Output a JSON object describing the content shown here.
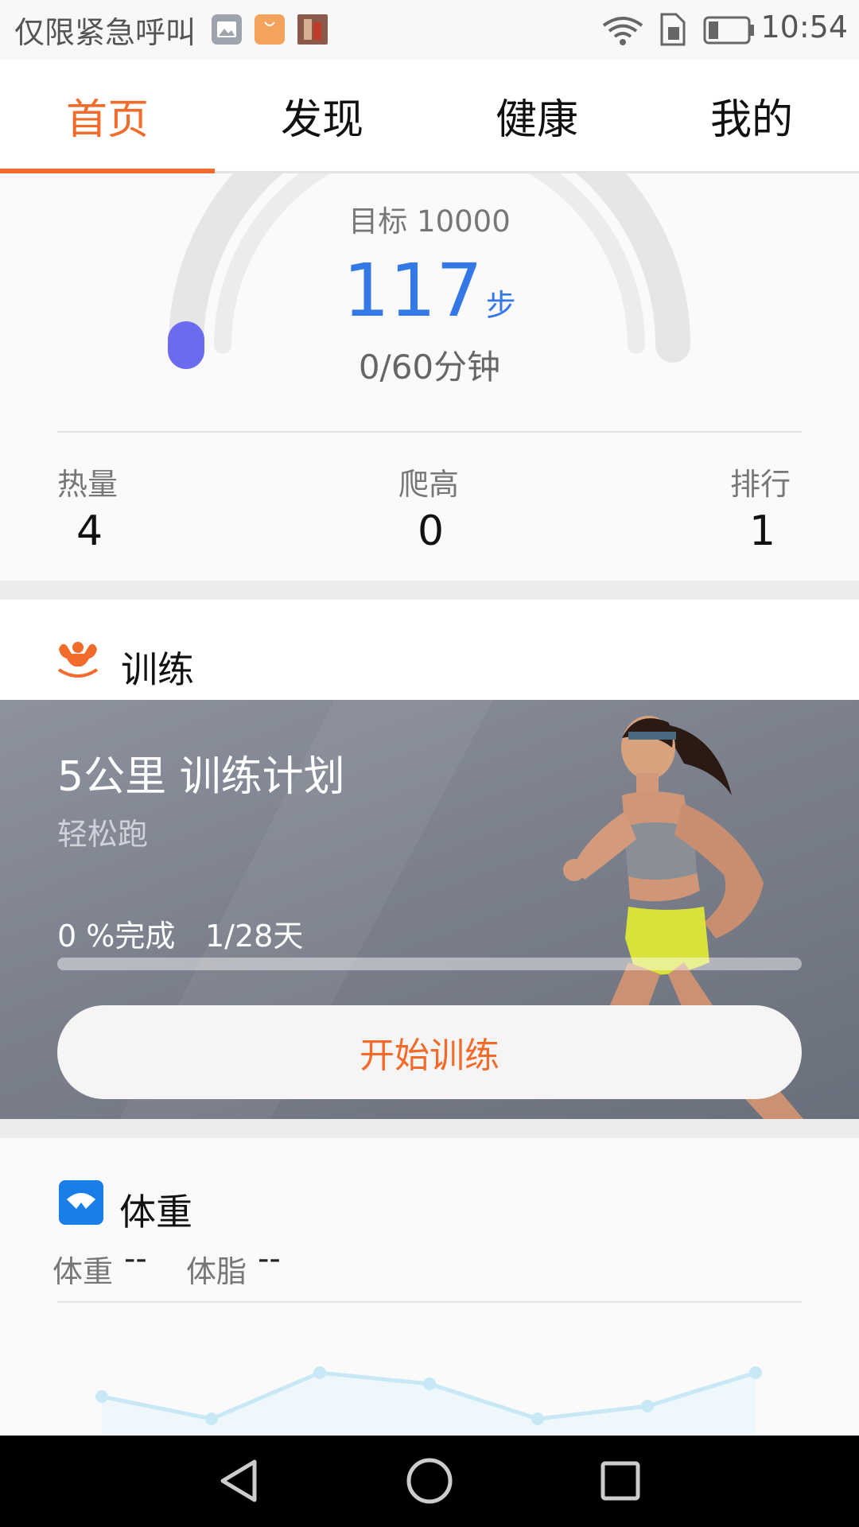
{
  "status_bar": {
    "carrier_text": "仅限紧急呼叫",
    "time": "10:54",
    "icons": [
      "gallery-notification-icon",
      "shop-notification-icon",
      "app-notification-icon",
      "wifi-icon",
      "sim-icon",
      "battery-icon"
    ]
  },
  "tabs": [
    {
      "label": "首页",
      "active": true
    },
    {
      "label": "发现",
      "active": false
    },
    {
      "label": "健康",
      "active": false
    },
    {
      "label": "我的",
      "active": false
    }
  ],
  "steps": {
    "goal": "目标 10000",
    "count": "117",
    "unit": "步",
    "minutes": "0/60分钟",
    "progress_fraction": 0.0117
  },
  "stats": [
    {
      "label": "热量",
      "value": "4"
    },
    {
      "label": "爬高",
      "value": "0"
    },
    {
      "label": "排行",
      "value": "1"
    }
  ],
  "training": {
    "section_title": "训练",
    "plan_title": "5公里 训练计划",
    "plan_subtitle": "轻松跑",
    "completion": "0 %完成",
    "days": "1/28天",
    "completion_fraction": 0,
    "start_button": "开始训练"
  },
  "weight": {
    "section_title": "体重",
    "weight_label": "体重",
    "weight_value": "--",
    "fat_label": "体脂",
    "fat_value": "--"
  },
  "colors": {
    "accent": "#f26b2b",
    "step_blue": "#3478e8",
    "gauge_knob": "#6b6bf0",
    "weight_icon": "#1a7ee8",
    "chart_line": "#c8e8f6"
  }
}
